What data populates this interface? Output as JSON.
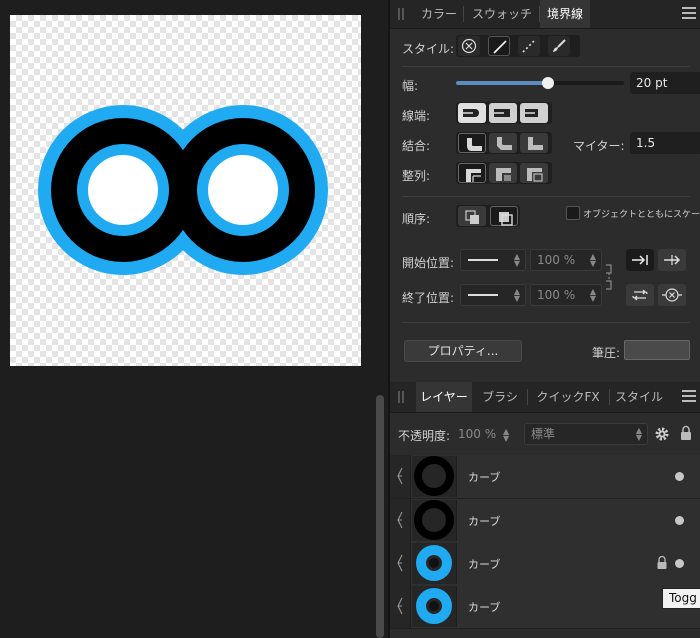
{
  "top_tabs": [
    "カラー",
    "スウォッチ",
    "境界線"
  ],
  "stroke": {
    "style_label": "スタイル:",
    "width_label": "幅:",
    "width_value": "20 pt",
    "width_fraction": 0.55,
    "cap_label": "線端:",
    "join_label": "結合:",
    "miter_label": "マイター:",
    "miter_value": "1.5",
    "align_label": "整列:",
    "order_label": "順序:",
    "scale_with_object_label": "オブジェクトとともにスケーリング",
    "start_label": "開始位置:",
    "start_percent": "100 %",
    "end_label": "終了位置:",
    "end_percent": "100 %",
    "properties_button": "プロパティ...",
    "pressure_label": "筆圧:"
  },
  "layer_tabs": [
    "レイヤー",
    "ブラシ",
    "クイックFX",
    "スタイル"
  ],
  "layers_toolbar": {
    "opacity_label": "不透明度:",
    "opacity_value": "100 %",
    "blend_mode": "標準"
  },
  "layers": [
    {
      "name": "カーブ",
      "thumb_color": "#000000",
      "locked": false
    },
    {
      "name": "カーブ",
      "thumb_color": "#000000",
      "locked": false
    },
    {
      "name": "カーブ",
      "thumb_color": "#1faaf2",
      "locked": true
    },
    {
      "name": "カーブ",
      "thumb_color": "#1faaf2",
      "locked": false
    }
  ],
  "tooltip": "Togg",
  "colors": {
    "accent_blue": "#1faaf2",
    "panel_bg": "#2c2c2c",
    "canvas_bg": "#1e1e1e"
  }
}
